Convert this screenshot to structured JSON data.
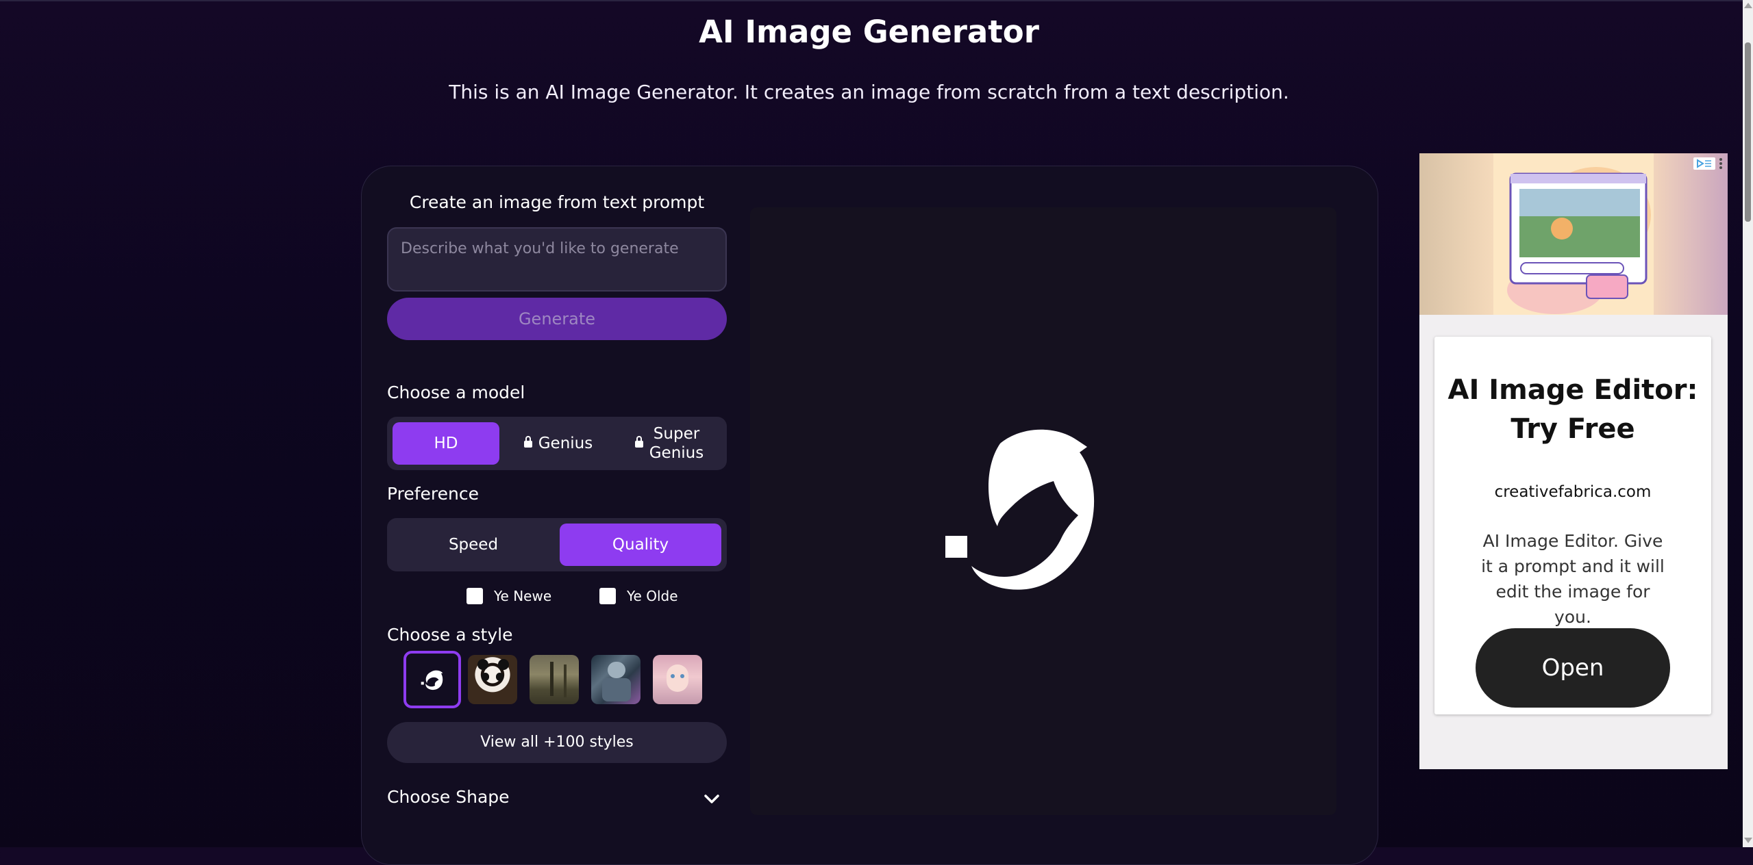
{
  "header": {
    "title": "AI Image Generator",
    "subtitle": "This is an AI Image Generator. It creates an image from scratch from a text description."
  },
  "prompt": {
    "title": "Create an image from text prompt",
    "placeholder": "Describe what you'd like to generate",
    "generate_label": "Generate"
  },
  "model": {
    "label": "Choose a model",
    "options": [
      {
        "label": "HD",
        "locked": false,
        "active": true
      },
      {
        "label": "Genius",
        "locked": true,
        "active": false
      },
      {
        "label": "Super Genius",
        "locked": true,
        "active": false
      }
    ]
  },
  "preference": {
    "label": "Preference",
    "options": [
      {
        "label": "Speed",
        "active": false
      },
      {
        "label": "Quality",
        "active": true
      }
    ]
  },
  "checkboxes": [
    {
      "label": "Ye Newe",
      "checked": false
    },
    {
      "label": "Ye Olde",
      "checked": false
    }
  ],
  "style": {
    "label": "Choose a style",
    "thumbnails": [
      "dolphin-logo-icon",
      "panda-thumbnail",
      "forest-thumbnail",
      "robot-thumbnail",
      "portrait-thumbnail"
    ],
    "view_all_label": "View all +100 styles"
  },
  "shape": {
    "label": "Choose Shape"
  },
  "ad": {
    "title": "AI Image Editor: Try Free",
    "domain": "creativefabrica.com",
    "description": "AI Image Editor. Give it a prompt and it will edit the image for you.",
    "cta": "Open"
  },
  "colors": {
    "accent": "#8e3cf0",
    "generate_button": "#5f2aa5",
    "background": "#0d0620",
    "panel": "#120d21"
  }
}
